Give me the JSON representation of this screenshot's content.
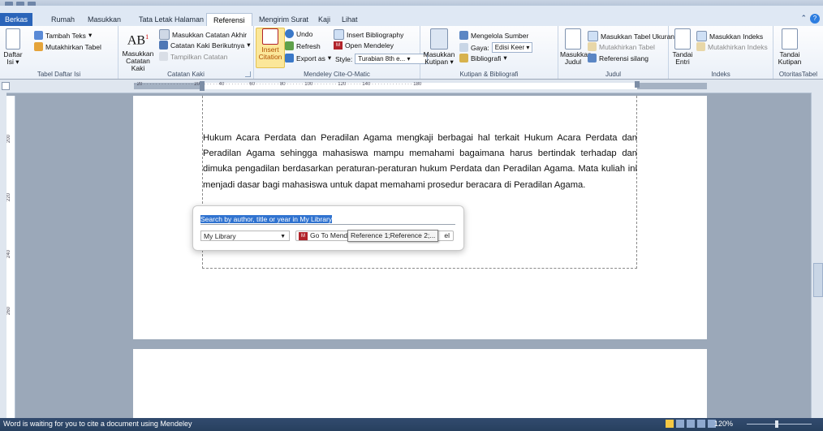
{
  "tabs": {
    "file": "Berkas",
    "items": [
      "Rumah",
      "Masukkan",
      "Tata Letak Halaman",
      "Referensi",
      "Mengirim Surat",
      "Kaji",
      "Lihat"
    ]
  },
  "ribbon": {
    "toc": {
      "big": "Daftar Isi",
      "add_text": "Tambah Teks",
      "update": "Mutakhirkan Tabel",
      "group": "Tabel Daftar Isi"
    },
    "footnotes": {
      "big": "Masukkan Catatan Kaki",
      "ab": "AB",
      "endnote": "Masukkan Catatan Akhir",
      "next": "Catatan Kaki Berikutnya",
      "show": "Tampilkan Catatan",
      "group": "Catatan Kaki"
    },
    "mendeley": {
      "insert": "Insert Citation",
      "undo": "Undo",
      "refresh": "Refresh",
      "export": "Export as",
      "bibliography": "Insert Bibliography",
      "open": "Open Mendeley",
      "style_label": "Style:",
      "style_value": "Turabian 8th e...",
      "group": "Mendeley Cite-O-Matic"
    },
    "citations": {
      "big": "Masukkan Kutipan",
      "manage": "Mengelola Sumber",
      "style_label": "Gaya:",
      "style_value": "Edisi Keer",
      "bibliography": "Bibliografi",
      "group": "Kutipan & Bibliografi"
    },
    "captions": {
      "big": "Masukkan Judul",
      "table_of_figures": "Masukkan Tabel Ukuran",
      "update": "Mutakhirkan Tabel",
      "cross_ref": "Referensi silang",
      "group": "Judul"
    },
    "index": {
      "big": "Tandai Entri",
      "insert": "Masukkan Indeks",
      "update": "Mutakhirkan Indeks",
      "group": "Indeks"
    },
    "authorities": {
      "big": "Tandai Kutipan",
      "group": "OtoritasTabel"
    }
  },
  "ruler": {
    "h_ticks": "· 20 · · · · · · · · · · · · · · · · · 20 · · · · · · 40 · · · · · · · · 60 · · · · · · · · 80 · · · · · · 100 · · · · · · · · 120 · · · · · 140 · · · · · · · · · · · · · · 180",
    "v_ticks": [
      "200",
      "220",
      "240",
      "260"
    ]
  },
  "document": {
    "paragraph": "Hukum Acara Perdata dan Peradilan Agama mengkaji berbagai hal terkait Hukum Acara Perdata dan Peradilan Agama sehingga mahasiswa mampu memahami bagaimana harus bertindak terhadap dan dimuka pengadilan berdasarkan peraturan-peraturan hukum Perdata dan Peradilan Agama.  Mata kuliah ini menjadi dasar bagi mahasiswa untuk dapat memahami prosedur beracara di Peradilan Agama."
  },
  "mendeley_popup": {
    "search_placeholder": "Search by author, title or year in My Library",
    "library": "My Library",
    "goto": "Go To Mende",
    "goto_tail": "el",
    "tooltip": "Reference 1;Reference 2;..."
  },
  "status": {
    "message": "Word is waiting for you to cite a document using Mendeley",
    "zoom": "120%"
  },
  "colors": {
    "file_tab": "#2a64b9",
    "statusbar": "#324b6e",
    "mendeley": "#b1232a",
    "selection": "#3073d0"
  }
}
